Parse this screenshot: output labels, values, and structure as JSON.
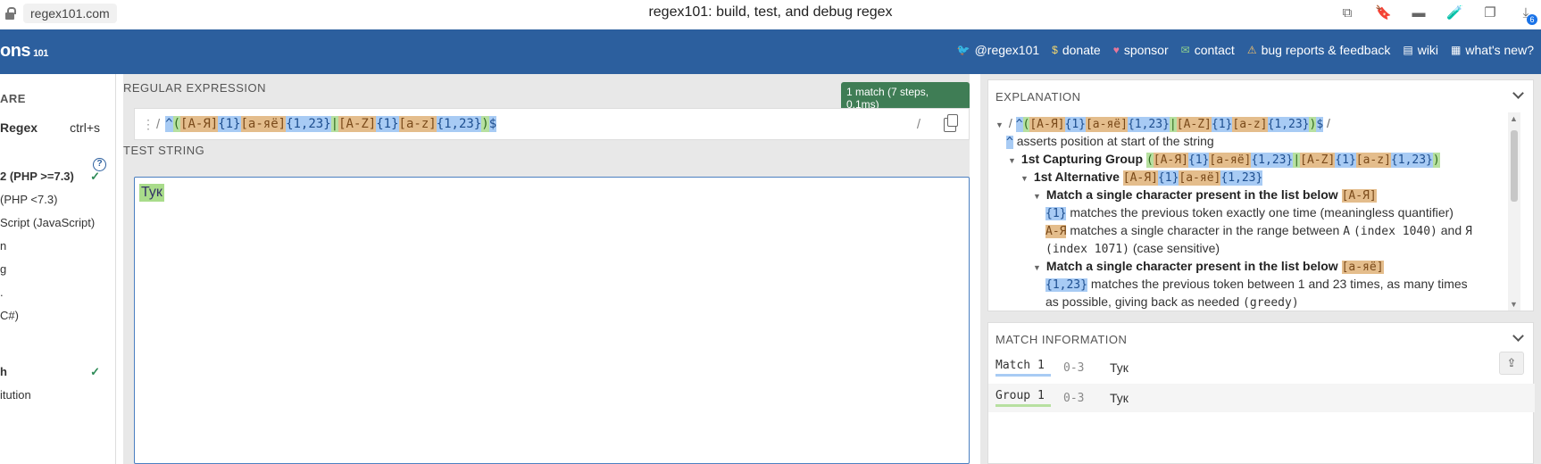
{
  "browser": {
    "url": "regex101.com",
    "title": "regex101: build, test, and debug regex",
    "download_count": "6"
  },
  "header": {
    "logo": "ons",
    "logo_suffix": "101",
    "links": [
      {
        "icon": "twitter-icon",
        "label": "@regex101"
      },
      {
        "icon": "dollar-icon",
        "label": "donate"
      },
      {
        "icon": "heart-icon",
        "label": "sponsor"
      },
      {
        "icon": "mail-icon",
        "label": "contact"
      },
      {
        "icon": "warning-icon",
        "label": "bug reports & feedback"
      },
      {
        "icon": "wiki-icon",
        "label": "wiki"
      },
      {
        "icon": "news-icon",
        "label": "what's new?"
      }
    ]
  },
  "sidebar": {
    "heading": "ARE",
    "save_label": "Regex",
    "save_shortcut": "ctrl+s",
    "help": "?",
    "flavors": [
      {
        "label": "2 (PHP >=7.3)",
        "active": true
      },
      {
        "label": "(PHP <7.3)",
        "active": false
      },
      {
        "label": "Script (JavaScript)",
        "active": false
      },
      {
        "label": "n",
        "active": false
      },
      {
        "label": "g",
        "active": false
      },
      {
        "label": ".",
        "active": false
      },
      {
        "label": "C#)",
        "active": false
      }
    ],
    "functions": [
      {
        "label": "h",
        "active": true
      },
      {
        "label": "itution",
        "active": false
      }
    ]
  },
  "editor": {
    "regex_label": "REGULAR EXPRESSION",
    "match_badge": "1 match (7 steps, 0.1ms)",
    "delimiter": "/",
    "regex_tokens": [
      {
        "t": "^",
        "k": "anchor"
      },
      {
        "t": "(",
        "k": "group"
      },
      {
        "t": "[А-Я]",
        "k": "class"
      },
      {
        "t": "{1}",
        "k": "quant"
      },
      {
        "t": "[а-яё]",
        "k": "class"
      },
      {
        "t": "{1,23}",
        "k": "quant"
      },
      {
        "t": "|",
        "k": "alt"
      },
      {
        "t": "[A-Z]",
        "k": "class"
      },
      {
        "t": "{1}",
        "k": "quant"
      },
      {
        "t": "[a-z]",
        "k": "class"
      },
      {
        "t": "{1,23}",
        "k": "quant"
      },
      {
        "t": ")",
        "k": "group"
      },
      {
        "t": "$",
        "k": "anchor"
      }
    ],
    "test_label": "TEST STRING",
    "test_string": "Тук"
  },
  "explanation": {
    "title": "EXPLANATION",
    "line1_regex": "^([А-Я]{1}[а-яё]{1,23}|[A-Z]{1}[a-z]{1,23})$",
    "line2_token": "^",
    "line2_text": "asserts position at start of the string",
    "line3_bold": "1st Capturing Group",
    "line3_code": "([А-Я]{1}[а-яё]{1,23}|[A-Z]{1}[a-z]{1,23})",
    "line4_bold": "1st Alternative",
    "line4_code": "[А-Я]{1}[а-яё]{1,23}",
    "line5_bold": "Match a single character present in the list below",
    "line5_code": "[А-Я]",
    "line6_code": "{1}",
    "line6_text": "matches the previous token exactly one time (meaningless quantifier)",
    "line7_code": "А-Я",
    "line7_text_a": "matches a single character in the range between",
    "line7_char1": "А",
    "line7_index1": "(index 1040)",
    "line7_and": "and",
    "line7_char2": "Я",
    "line8_index2": "(index 1071)",
    "line8_text": "(case sensitive)",
    "line9_bold": "Match a single character present in the list below",
    "line9_code": "[а-яё]",
    "line10_code": "{1,23}",
    "line10_text": "matches the previous token between 1 and 23 times, as many times",
    "line11_text": "as possible, giving back as needed",
    "line11_code": "(greedy)"
  },
  "match_info": {
    "title": "MATCH INFORMATION",
    "rows": [
      {
        "label": "Match 1",
        "range": "0-3",
        "value": "Тук",
        "color": "#a8cbf4"
      },
      {
        "label": "Group 1",
        "range": "0-3",
        "value": "Тук",
        "color": "#b7e0a0"
      }
    ]
  }
}
